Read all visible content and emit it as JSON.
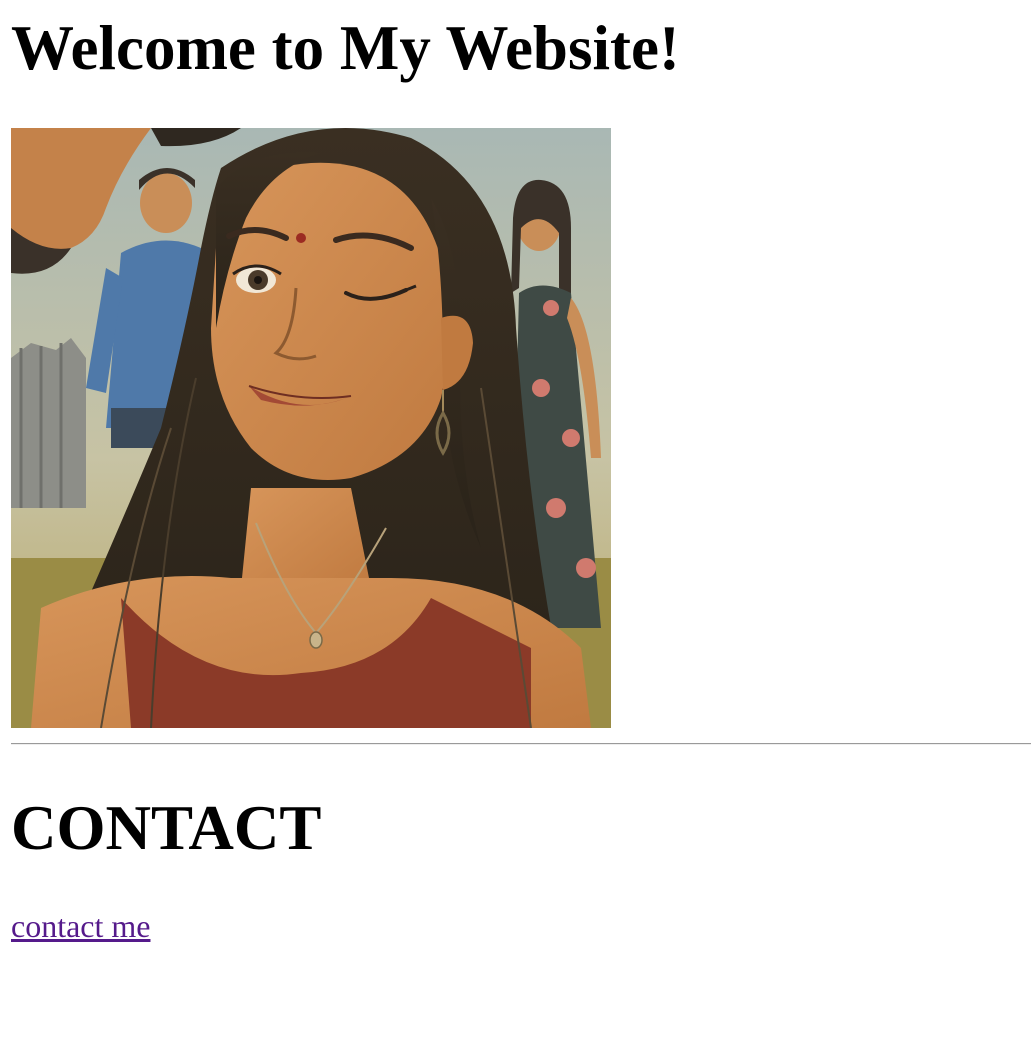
{
  "header": {
    "title": "Welcome to My Website!"
  },
  "hero": {
    "alt": "Illustrated portrait of a smiling winking woman with long dark hair, red bindi, earrings and a pendant necklace, with people standing in a field behind her"
  },
  "contact": {
    "heading": "CONTACT",
    "link_text": "contact me"
  },
  "colors": {
    "link_visited": "#551a8b",
    "divider": "#9a9a9a",
    "background": "#ffffff"
  }
}
